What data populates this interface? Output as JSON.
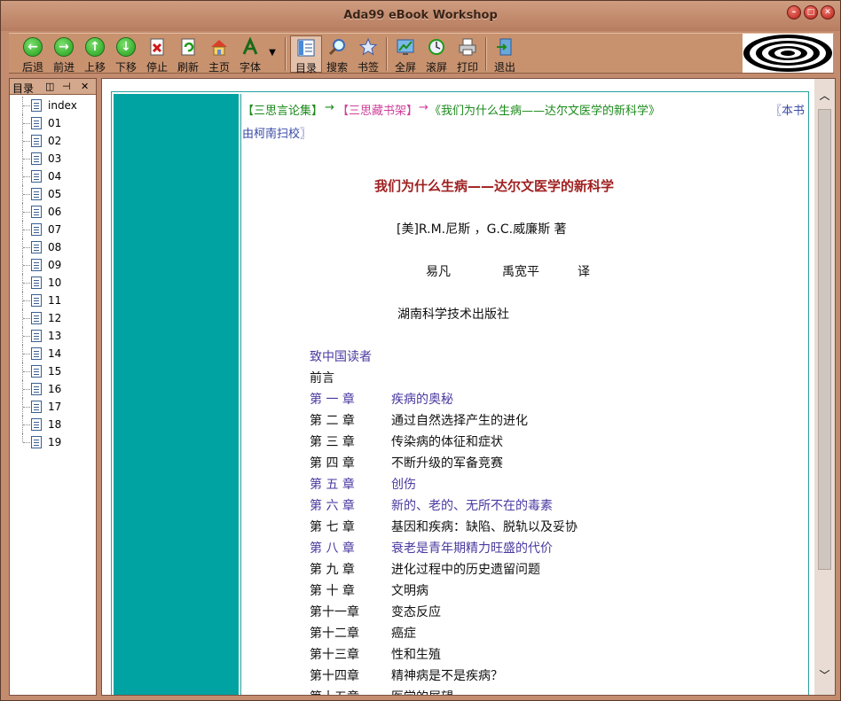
{
  "window": {
    "title": "Ada99 eBook Workshop"
  },
  "toolbar": {
    "back": "后退",
    "forward": "前进",
    "up": "上移",
    "down": "下移",
    "stop": "停止",
    "refresh": "刷新",
    "home": "主页",
    "font": "字体",
    "toc": "目录",
    "search": "搜索",
    "bookmark": "书签",
    "fullscreen": "全屏",
    "scroll": "滚屏",
    "print": "打印",
    "exit": "退出"
  },
  "sidebar": {
    "title": "目录",
    "items": [
      "index",
      "01",
      "02",
      "03",
      "04",
      "05",
      "06",
      "07",
      "08",
      "09",
      "10",
      "11",
      "12",
      "13",
      "14",
      "15",
      "16",
      "17",
      "18",
      "19"
    ]
  },
  "content": {
    "breadcrumb": {
      "part1": "【三思言论集】",
      "arrow1": "→",
      "part2": "【三思藏书架】",
      "arrow2": "→",
      "part3": "《我们为什么生病——达尔文医学的新科学》",
      "note_a": "〖本书",
      "note_b": "由柯南扫校〗"
    },
    "title": "我们为什么生病——达尔文医学的新科学",
    "authors": "[美]R.M.尼斯 ，G.C.威廉斯 著",
    "translator1": "易凡",
    "translator2": "禹宽平",
    "translate_label": "译",
    "publisher": "湖南科学技术出版社",
    "toc": [
      {
        "ch": "致中国读者",
        "title": "",
        "link": true
      },
      {
        "ch": "前言",
        "title": "",
        "link": false
      },
      {
        "ch": "第 一 章",
        "title": "疾病的奥秘",
        "link": true
      },
      {
        "ch": "第 二 章",
        "title": "通过自然选择产生的进化",
        "link": false
      },
      {
        "ch": "第 三 章",
        "title": "传染病的体征和症状",
        "link": false
      },
      {
        "ch": "第 四 章",
        "title": "不断升级的军备竞赛",
        "link": false
      },
      {
        "ch": "第 五 章",
        "title": "创伤",
        "link": true
      },
      {
        "ch": "第 六 章",
        "title": "新的、老的、无所不在的毒素",
        "link": true
      },
      {
        "ch": "第 七 章",
        "title": "基因和疾病：缺陷、脱轨以及妥协",
        "link": false
      },
      {
        "ch": "第 八 章",
        "title": "衰老是青年期精力旺盛的代价",
        "link": true
      },
      {
        "ch": "第 九 章",
        "title": "进化过程中的历史遗留问题",
        "link": false
      },
      {
        "ch": "第 十 章",
        "title": "文明病",
        "link": false
      },
      {
        "ch": "第十一章",
        "title": "变态反应",
        "link": false
      },
      {
        "ch": "第十二章",
        "title": "癌症",
        "link": false
      },
      {
        "ch": "第十三章",
        "title": "性和生殖",
        "link": false
      },
      {
        "ch": "第十四章",
        "title": "精神病是不是疾病？",
        "link": false
      },
      {
        "ch": "第十五章",
        "title": "医学的展望",
        "link": false
      }
    ]
  }
}
